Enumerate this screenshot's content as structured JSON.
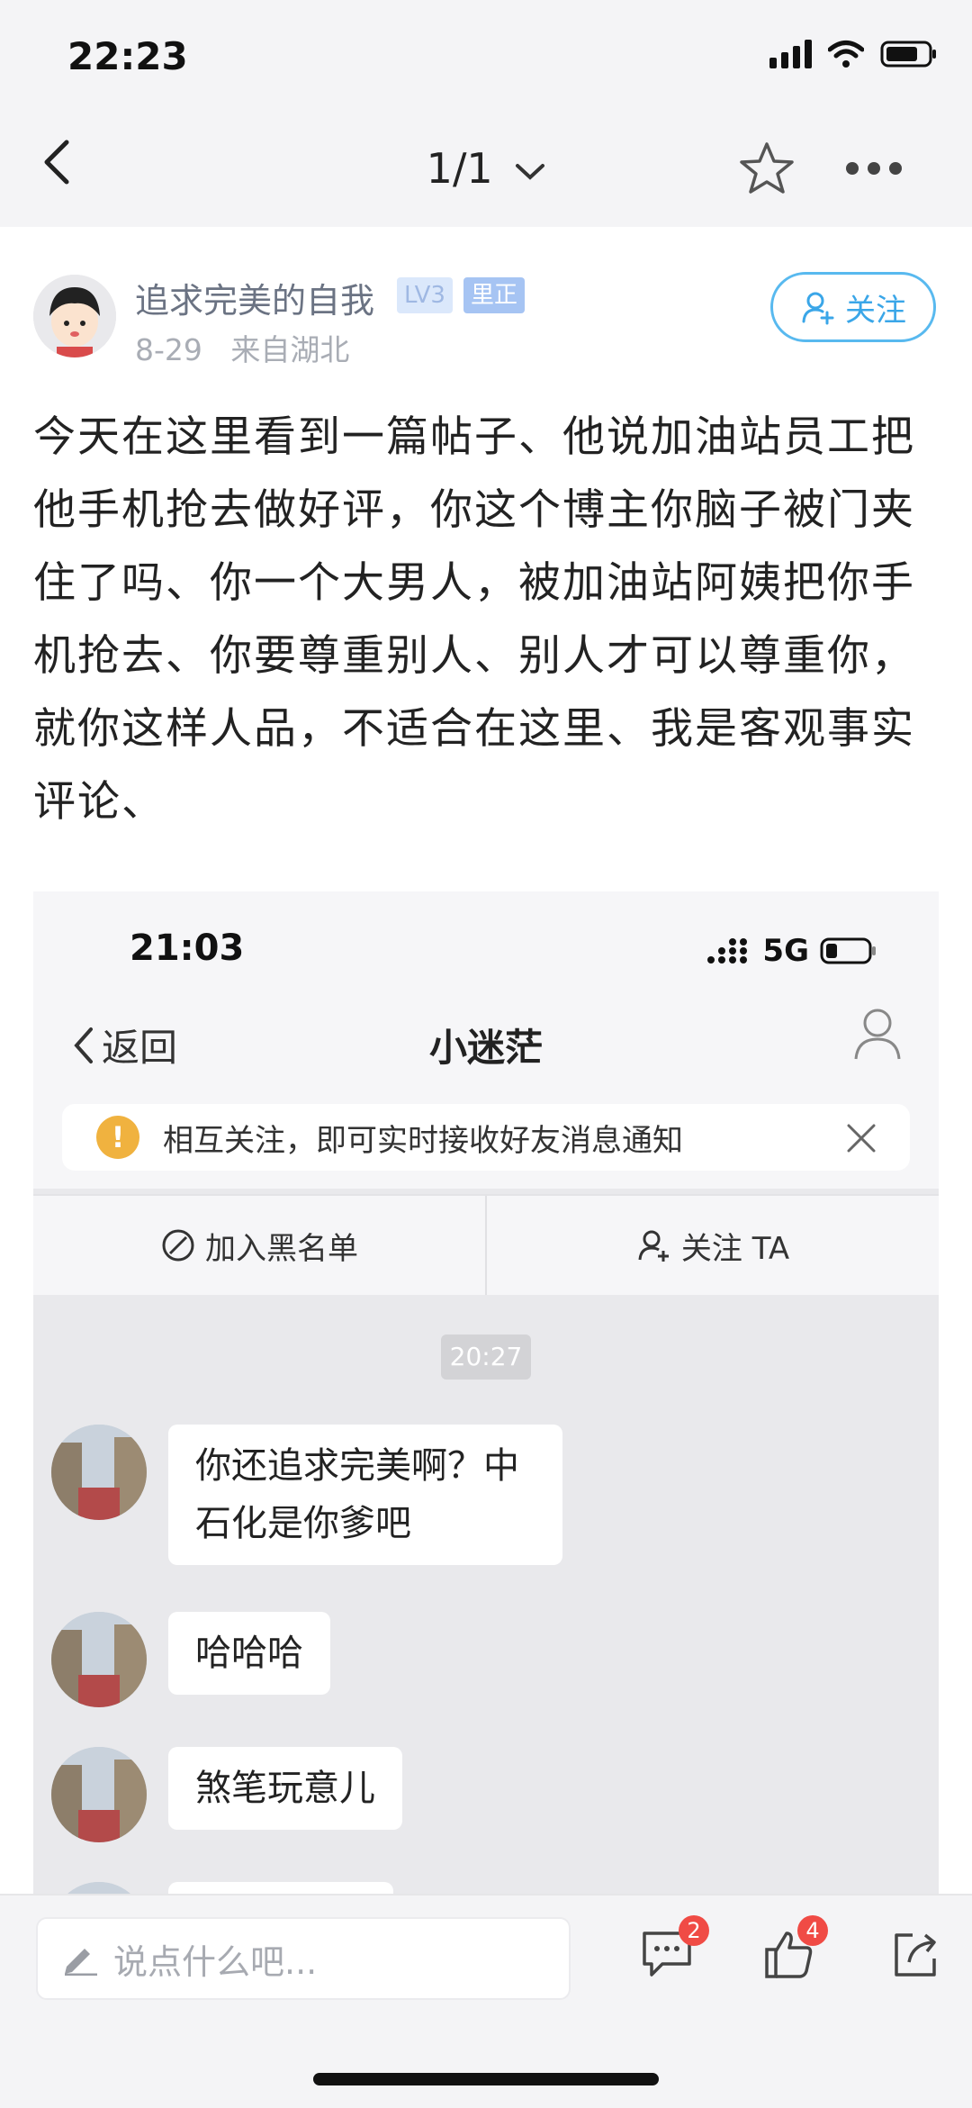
{
  "status_bar": {
    "time": "22:23"
  },
  "nav": {
    "page_indicator": "1/1"
  },
  "author": {
    "name": "追求完美的自我",
    "level_tag": "LV3",
    "op_tag": "里正",
    "date": "8-29",
    "location": "来自湖北",
    "follow_label": "关注"
  },
  "post": {
    "text": "今天在这里看到一篇帖子、他说加油站员工把他手机抢去做好评，你这个博主你脑子被门夹住了吗、你一个大男人，被加油站阿姨把你手机抢去、你要尊重别人、别人才可以尊重你，就你这样人品，不适合在这里、我是客观事实评论、"
  },
  "screenshot": {
    "time": "21:03",
    "network": "5G",
    "back_label": "返回",
    "title": "小迷茫",
    "notice": "相互关注，即可实时接收好友消息通知",
    "block_label": "加入黑名单",
    "follow_ta_label": "关注 TA",
    "timestamp": "20:27",
    "messages": [
      {
        "text": "你还追求完美啊？中石化是你爹吧"
      },
      {
        "text": "哈哈哈"
      },
      {
        "text": "煞笔玩意儿"
      }
    ]
  },
  "bottom": {
    "comment_placeholder": "说点什么吧...",
    "comment_count": "2",
    "like_count": "4"
  },
  "colors": {
    "accent": "#3aa6e8",
    "badge": "#f04b45",
    "notice_icon": "#f0b23f"
  }
}
